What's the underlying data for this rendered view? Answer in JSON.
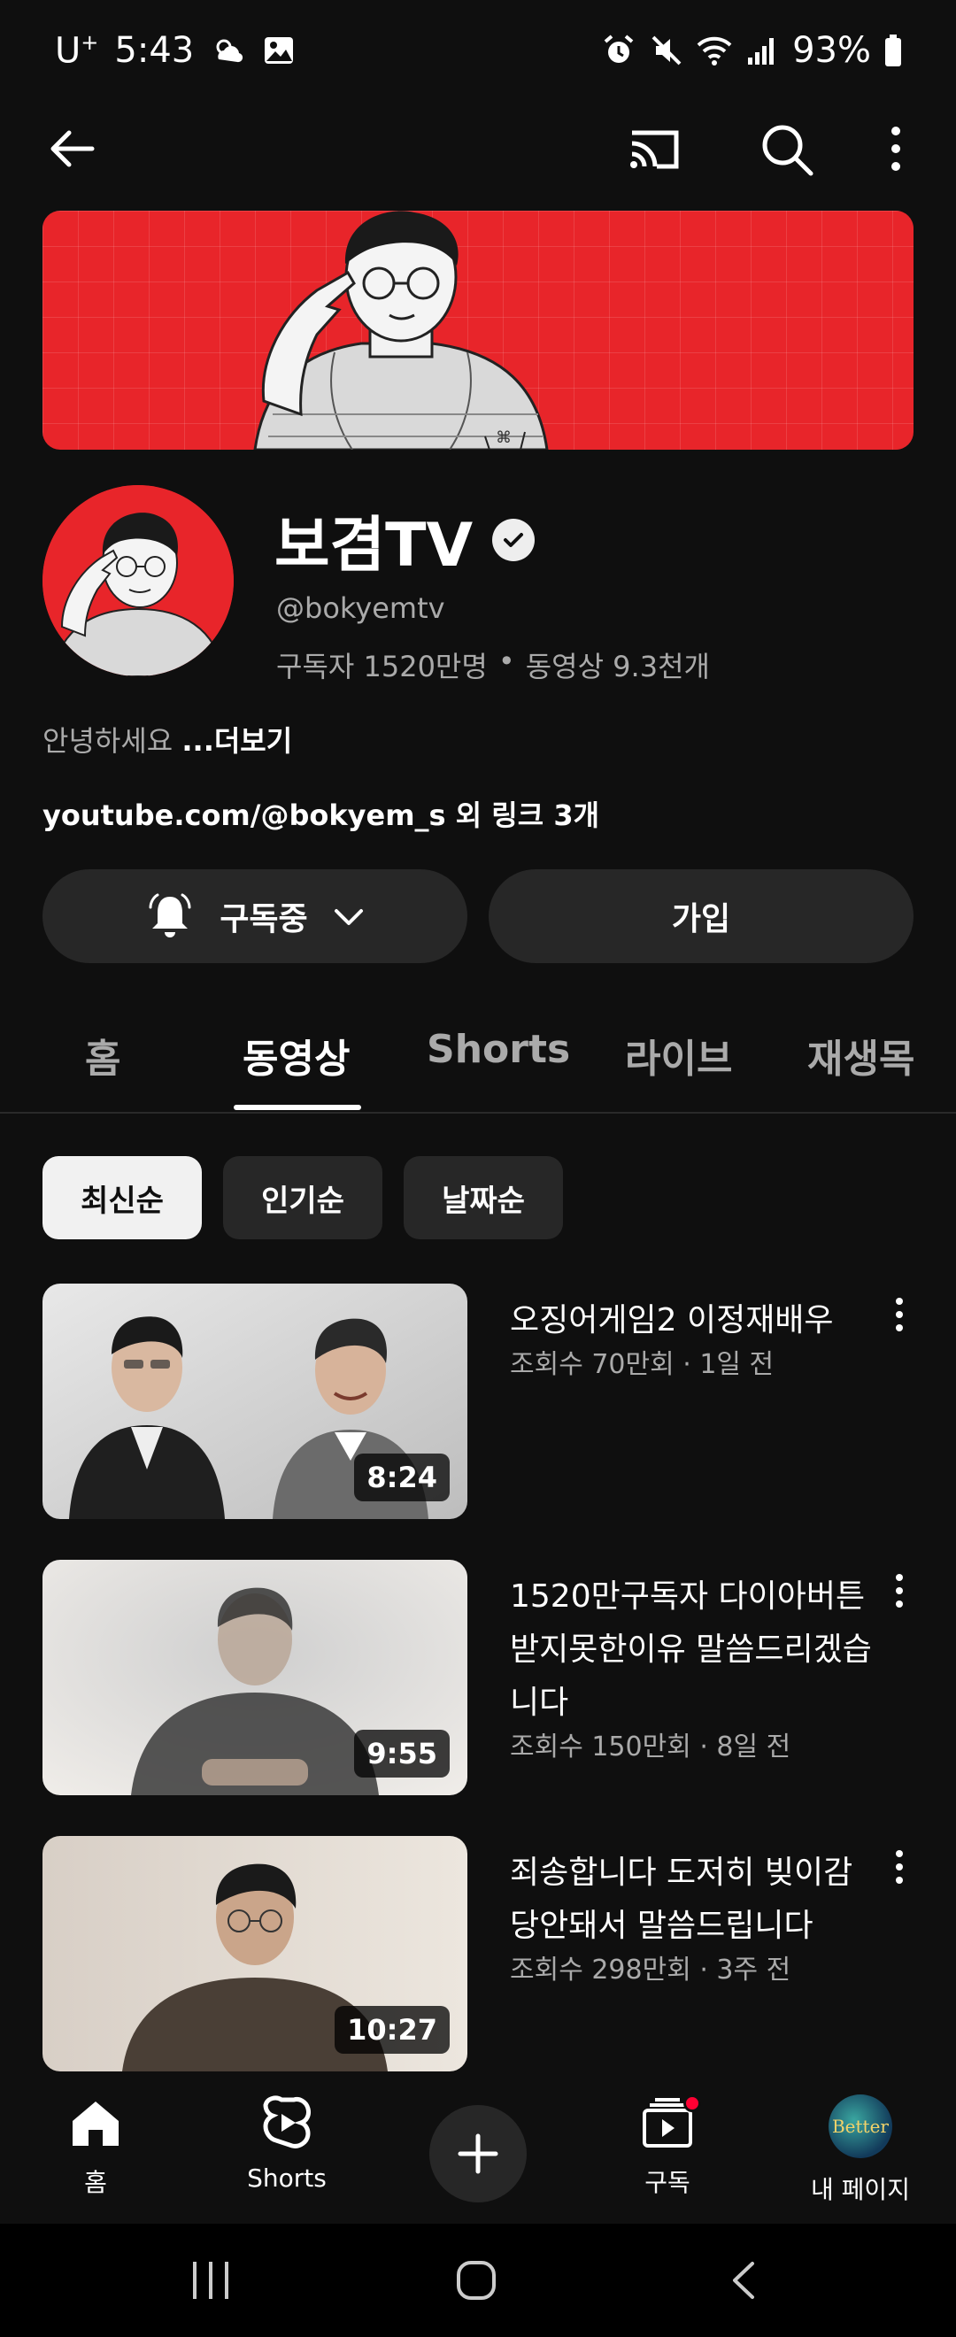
{
  "status_bar": {
    "carrier": "U",
    "carrier_sup": "+",
    "time": "5:43",
    "battery": "93%"
  },
  "channel": {
    "name": "보겸TV",
    "handle": "@bokyemtv",
    "subscribers": "구독자 1520만명",
    "videos_count": "동영상 9.3천개",
    "separator": "•",
    "description": "안녕하세요 ",
    "more_label": "...더보기",
    "links": "youtube.com/@bokyem_s 외 링크 3개"
  },
  "buttons": {
    "subscribed": "구독중",
    "join": "가입"
  },
  "tabs": [
    {
      "label": "홈"
    },
    {
      "label": "동영상"
    },
    {
      "label": "Shorts"
    },
    {
      "label": "라이브"
    },
    {
      "label": "재생목"
    }
  ],
  "active_tab": "동영상",
  "chips": [
    {
      "label": "최신순"
    },
    {
      "label": "인기순"
    },
    {
      "label": "날짜순"
    }
  ],
  "videos": [
    {
      "title": "오징어게임2 이정재배우",
      "meta": "조회수 70만회 · 1일 전",
      "duration": "8:24"
    },
    {
      "title": "1520만구독자 다이아버튼 받지못한이유 말씀드리겠습니다",
      "meta": "조회수 150만회 · 8일 전",
      "duration": "9:55"
    },
    {
      "title": "죄송합니다 도저히 빚이감당안돼서 말씀드립니다",
      "meta": "조회수 298만회 · 3주 전",
      "duration": "10:27"
    }
  ],
  "bottom_nav": {
    "home": "홈",
    "shorts": "Shorts",
    "subscriptions": "구독",
    "you": "내 페이지",
    "avatar_text": "Better"
  },
  "colors": {
    "accent": "#ff0033",
    "banner": "#e8252a",
    "bg": "#0f0f0f",
    "chip": "#272727"
  }
}
